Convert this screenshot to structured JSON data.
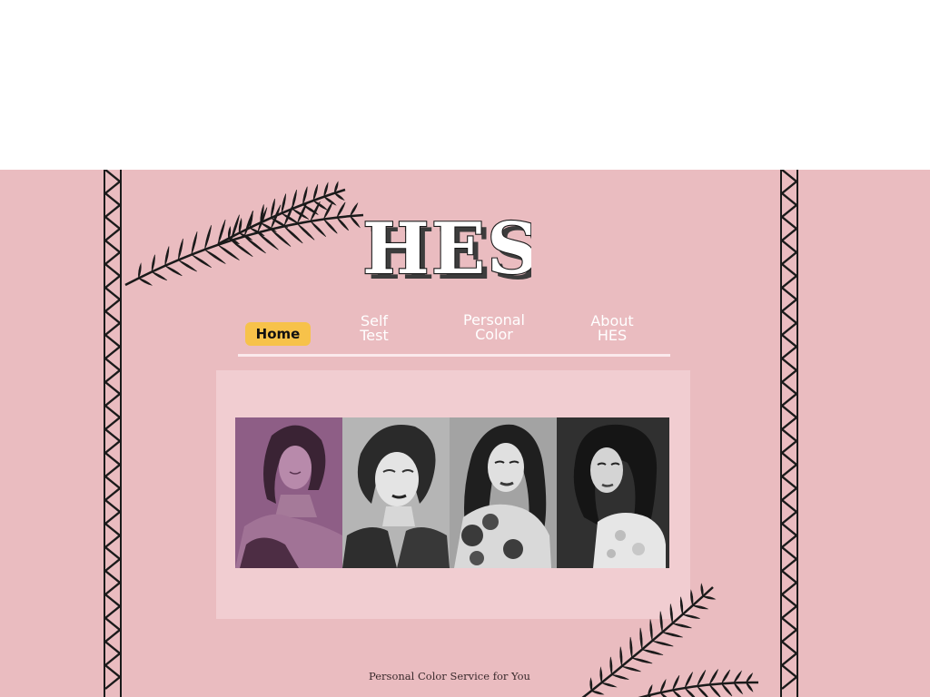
{
  "brand": {
    "logo_text": "HES"
  },
  "nav": {
    "items": [
      {
        "label": "Home",
        "active": true
      },
      {
        "label": "Self\nTest",
        "active": false
      },
      {
        "label": "Personal\nColor",
        "active": false
      },
      {
        "label": "About\nHES",
        "active": false
      }
    ]
  },
  "gallery": {
    "photo_count": 4
  },
  "footer": {
    "tagline": "Personal Color Service for You"
  },
  "colors": {
    "background": "#eabcc0",
    "panel": "#f1cdd1",
    "nav_active": "#f7c24a",
    "nav_text": "#ffffff",
    "ink": "#1a1a1a"
  },
  "icons": [
    "fern-branch-icon",
    "zigzag-border"
  ]
}
